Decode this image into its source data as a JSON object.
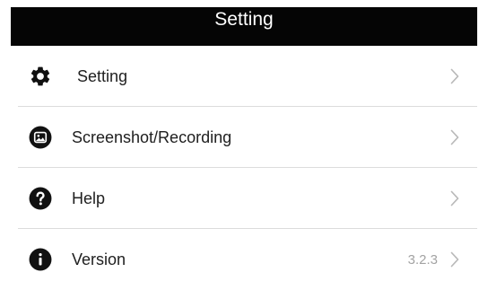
{
  "header": {
    "title": "Setting"
  },
  "menu": {
    "items": [
      {
        "label": "Setting",
        "icon": "gear-icon"
      },
      {
        "label": "Screenshot/Recording",
        "icon": "image-icon"
      },
      {
        "label": "Help",
        "icon": "question-icon"
      },
      {
        "label": "Version",
        "icon": "info-icon",
        "value": "3.2.3"
      }
    ]
  },
  "colors": {
    "header_background": "#050505",
    "header_text": "#ffffff",
    "icon": "#111111",
    "chevron": "#b8b8b8",
    "divider": "#dcdcdc",
    "secondary_text": "#a3a3a3"
  }
}
